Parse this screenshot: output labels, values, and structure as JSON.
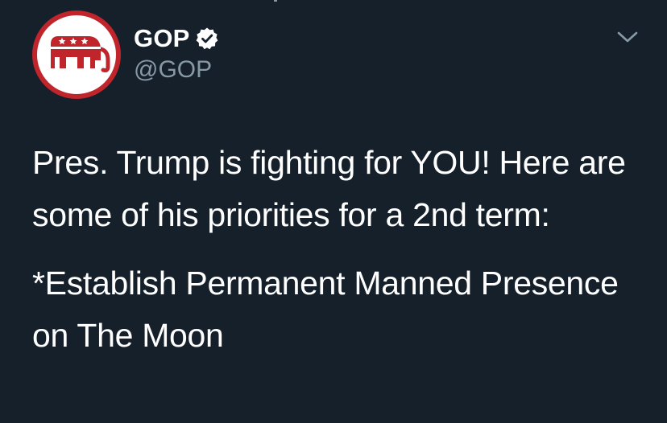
{
  "tweet": {
    "display_name": "GOP",
    "handle": "@GOP",
    "verified": true,
    "avatar_icon": "republican-elephant-logo",
    "more_icon": "chevron-down-icon",
    "text_paragraph_1": "Pres. Trump is fighting for YOU! Here are some of his priorities for a 2nd term:",
    "text_paragraph_2": "*Establish Permanent Manned Presence on The Moon"
  },
  "colors": {
    "background": "#15202b",
    "primary_text": "#ffffff",
    "secondary_text": "#8899a6",
    "avatar_red": "#c0252c"
  }
}
